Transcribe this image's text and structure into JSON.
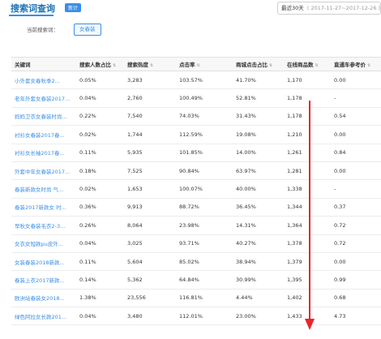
{
  "header": {
    "title": "搜索词查询",
    "badge": "新计",
    "date_label": "最近30天",
    "date_range": "( 2017-11-27~2017-12-26 )"
  },
  "search": {
    "label": "当前搜索词：",
    "tag": "女春装"
  },
  "columns": [
    "关键词",
    "搜索人数占比",
    "搜索热度",
    "点击率",
    "商城点击占比",
    "在线商品数",
    "直通车参考价"
  ],
  "rows": [
    [
      "小外套女春秋季2...",
      "0.05%",
      "3,283",
      "103.57%",
      "41.70%",
      "1,170",
      "0.00"
    ],
    [
      "老年外套女春装2017...",
      "0.04%",
      "2,760",
      "100.49%",
      "52.81%",
      "1,178",
      "-"
    ],
    [
      "妈妈卫衣女春装时尚...",
      "0.22%",
      "7,540",
      "74.03%",
      "31.43%",
      "1,178",
      "0.54"
    ],
    [
      "衬衫女春装2017春...",
      "0.02%",
      "1,744",
      "112.59%",
      "19.08%",
      "1,210",
      "0.00"
    ],
    [
      "衬衫女长袖2017春...",
      "0.11%",
      "5,935",
      "101.85%",
      "14.00%",
      "1,261",
      "0.84"
    ],
    [
      "外套中年女春装2017...",
      "0.18%",
      "7,525",
      "90.84%",
      "63.97%",
      "1,281",
      "0.00"
    ],
    [
      "春装新款女时尚 气...",
      "0.02%",
      "1,653",
      "100.07%",
      "40.00%",
      "1,338",
      "-"
    ],
    [
      "春装2017新款女 时...",
      "0.36%",
      "9,913",
      "88.72%",
      "36.45%",
      "1,344",
      "0.37"
    ],
    [
      "早秋女春装毛衣2-3...",
      "0.26%",
      "8,064",
      "23.98%",
      "14.31%",
      "1,364",
      "0.72"
    ],
    [
      "女衣女短款pu皮外...",
      "0.04%",
      "3,025",
      "93.71%",
      "40.27%",
      "1,378",
      "0.72"
    ],
    [
      "女装春装2018新款...",
      "0.11%",
      "5,604",
      "85.02%",
      "38.94%",
      "1,379",
      "0.00"
    ],
    [
      "春装上衣2017新款...",
      "0.14%",
      "5,362",
      "64.84%",
      "30.99%",
      "1,395",
      "0.99"
    ],
    [
      "欧洲站春装女2018...",
      "1.38%",
      "23,556",
      "116.81%",
      "4.44%",
      "1,402",
      "0.68"
    ],
    [
      "绿色阿拉女长款201...",
      "0.04%",
      "3,480",
      "112.01%",
      "23.00%",
      "1,433",
      "4.73"
    ]
  ],
  "icons": {
    "sort": "sort-icon"
  },
  "colors": {
    "accent": "#3a8ee6",
    "arrow": "#e8262b"
  }
}
